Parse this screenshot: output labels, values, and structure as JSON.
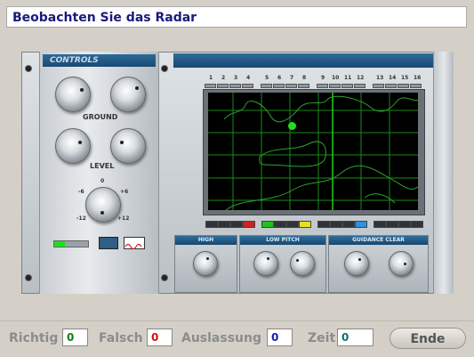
{
  "header": {
    "title": "Beobachten Sie das Radar"
  },
  "panel": {
    "controls_title": "CONTROLS",
    "ground_label": "GROUND",
    "level_label": "LEVEL",
    "dial_marks": {
      "top": "0",
      "left": "-6",
      "right": "+6",
      "bottom_left": "-12",
      "bottom_right": "+12"
    },
    "channels": [
      "1",
      "2",
      "3",
      "4",
      "5",
      "6",
      "7",
      "8",
      "9",
      "10",
      "11",
      "12",
      "13",
      "14",
      "15",
      "16"
    ],
    "sections": {
      "high": "HIGH",
      "low_pitch": "LOW PITCH",
      "guidance_clear": "GUIDANCE CLEAR"
    },
    "radar": {
      "target_color": "#1ee01e"
    },
    "indicator_colors": {
      "red": "#d02020",
      "green": "#20c020",
      "yellow": "#e8e020",
      "blue": "#3090e0"
    }
  },
  "footer": {
    "correct_label": "Richtig",
    "correct_value": "0",
    "correct_color": "#108010",
    "wrong_label": "Falsch",
    "wrong_value": "0",
    "wrong_color": "#d01010",
    "omission_label": "Auslassung",
    "omission_value": "0",
    "omission_color": "#1020b0",
    "time_label": "Zeit",
    "time_value": "0",
    "time_color": "#107070",
    "end_button": "Ende"
  }
}
